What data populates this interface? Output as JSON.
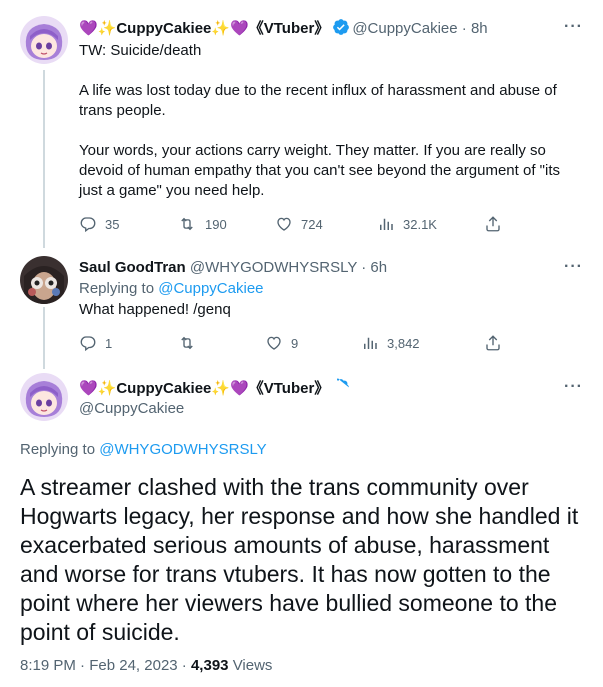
{
  "tweet1": {
    "display_name": "💜✨CuppyCakiee✨💜《VTuber》",
    "handle": "@CuppyCakiee",
    "time": "8h",
    "tw_line": "TW: Suicide/death",
    "para1": "A life was lost today due to the recent influx of harassment and abuse of trans people.",
    "para2": "Your words, your actions carry weight. They matter. If you are really so devoid of human empathy that you can't see beyond the argument of \"its just a game\" you need help.",
    "replies": "35",
    "retweets": "190",
    "likes": "724",
    "views": "32.1K"
  },
  "tweet2": {
    "display_name": "Saul GoodTran",
    "handle": "@WHYGODWHYSRSLY",
    "time": "6h",
    "replying_prefix": "Replying to",
    "replying_to": "@CuppyCakiee",
    "text": "What happened! /genq",
    "replies": "1",
    "retweets": "",
    "likes": "9",
    "views": "3,842"
  },
  "main_tweet": {
    "display_name": "💜✨CuppyCakiee✨💜《VTuber》",
    "handle": "@CuppyCakiee",
    "replying_prefix": "Replying to",
    "replying_to": "@WHYGODWHYSRSLY",
    "text": "A streamer clashed with the trans community over Hogwarts legacy, her response and how she handled it exacerbated serious amounts of abuse, harassment and worse for trans vtubers. It has now gotten to the point where her viewers have bullied someone to the point of suicide.",
    "time": "8:19 PM",
    "date": "Feb 24, 2023",
    "views_count": "4,393",
    "views_label": "Views"
  },
  "colors": {
    "text": "#0f1419",
    "muted": "#536471",
    "link": "#1d9bf0",
    "verified": "#1d9bf0"
  },
  "icons": [
    "reply-icon",
    "retweet-icon",
    "like-icon",
    "views-icon",
    "share-icon",
    "more-icon",
    "verified-icon"
  ]
}
